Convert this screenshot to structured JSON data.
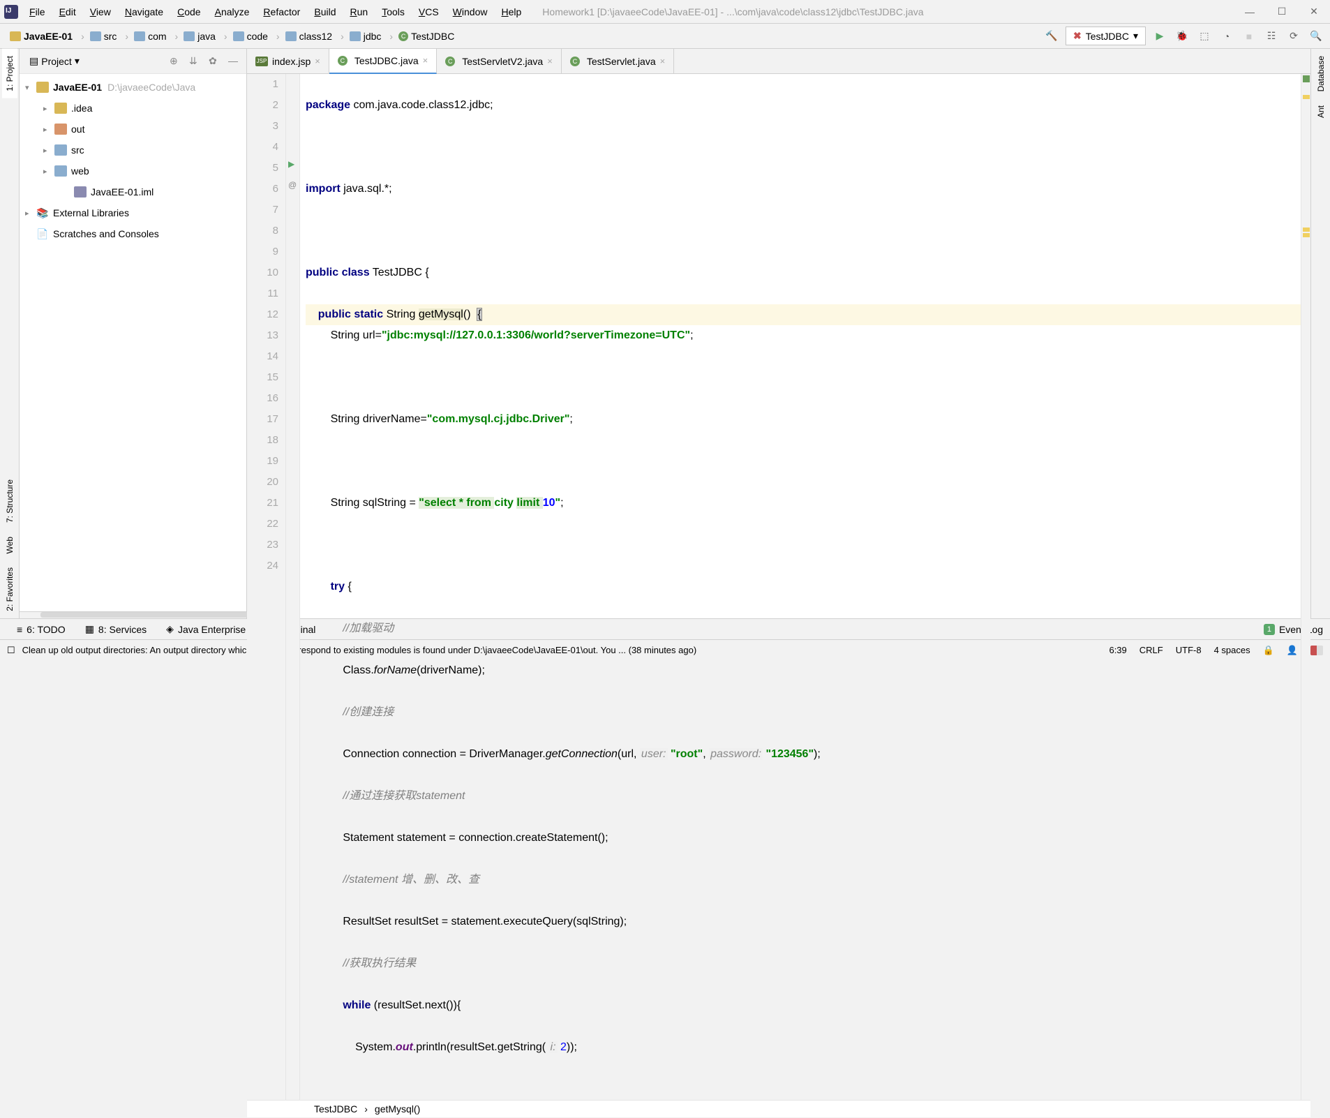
{
  "menu": [
    "File",
    "Edit",
    "View",
    "Navigate",
    "Code",
    "Analyze",
    "Refactor",
    "Build",
    "Run",
    "Tools",
    "VCS",
    "Window",
    "Help"
  ],
  "title_path": "Homework1 [D:\\javaeeCode\\JavaEE-01] - ...\\com\\java\\code\\class12\\jdbc\\TestJDBC.java",
  "breadcrumbs": [
    "JavaEE-01",
    "src",
    "com",
    "java",
    "code",
    "class12",
    "jdbc",
    "TestJDBC"
  ],
  "run_config": "TestJDBC",
  "project": {
    "header": "Project",
    "root_name": "JavaEE-01",
    "root_path": "D:\\javaeeCode\\Java",
    "items": [
      ".idea",
      "out",
      "src",
      "web",
      "JavaEE-01.iml"
    ],
    "external": "External Libraries",
    "scratches": "Scratches and Consoles"
  },
  "tabs": [
    {
      "label": "index.jsp",
      "type": "jsp"
    },
    {
      "label": "TestJDBC.java",
      "type": "class",
      "active": true
    },
    {
      "label": "TestServletV2.java",
      "type": "class"
    },
    {
      "label": "TestServlet.java",
      "type": "class"
    }
  ],
  "code": {
    "lines": [
      {
        "n": 1
      },
      {
        "n": 2
      },
      {
        "n": 3
      },
      {
        "n": 4
      },
      {
        "n": 5
      },
      {
        "n": 6
      },
      {
        "n": 7
      },
      {
        "n": 8
      },
      {
        "n": 9
      },
      {
        "n": 10
      },
      {
        "n": 11
      },
      {
        "n": 12
      },
      {
        "n": 13
      },
      {
        "n": 14
      },
      {
        "n": 15
      },
      {
        "n": 16
      },
      {
        "n": 17
      },
      {
        "n": 18
      },
      {
        "n": 19
      },
      {
        "n": 20
      },
      {
        "n": 21
      },
      {
        "n": 22
      },
      {
        "n": 23
      },
      {
        "n": 24
      }
    ],
    "c1_kw": "package",
    "c1_rest": " com.java.code.class12.jdbc;",
    "c3_kw": "import",
    "c3_rest": " java.sql.*;",
    "c5_kw1": "public",
    "c5_kw2": "class",
    "c5_rest": " TestJDBC {",
    "c6_kw1": "public",
    "c6_kw2": "static",
    "c6_rest1": " String ",
    "c6_method": "getMysql",
    "c6_rest2": "()",
    "c6_brace": "{",
    "c7_a": "        String url=",
    "c7_str": "\"jdbc:mysql://127.0.0.1:3306/world?serverTimezone=UTC\"",
    "c7_b": ";",
    "c9_a": "        String driverName=",
    "c9_str": "\"com.mysql.cj.jdbc.Driver\"",
    "c9_b": ";",
    "c11_a": "        String sqlString = ",
    "c11_s1": "\"select * from ",
    "c11_s2": "city ",
    "c11_s3": "limit ",
    "c11_s4": "10",
    "c11_s5": "\"",
    "c11_b": ";",
    "c13_kw": "try",
    "c13_rest": " {",
    "c14": "            //加载驱动",
    "c15_a": "            Class.",
    "c15_m": "forName",
    "c15_b": "(driverName);",
    "c16": "            //创建连接",
    "c17_a": "            Connection connection = DriverManager.",
    "c17_m": "getConnection",
    "c17_b": "(url, ",
    "c17_h1": "user:",
    "c17_s1": " \"root\"",
    "c17_c": ", ",
    "c17_h2": "password:",
    "c17_s2": " \"123456\"",
    "c17_d": ");",
    "c18": "            //通过连接获取statement",
    "c19": "            Statement statement = connection.createStatement();",
    "c20": "            //statement 增、删、改、查",
    "c21": "            ResultSet resultSet = statement.executeQuery(sqlString);",
    "c22": "            //获取执行结果",
    "c23_kw": "while",
    "c23_rest": " (resultSet.next()){",
    "c24_a": "                System.",
    "c24_out": "out",
    "c24_b": ".println(resultSet.getString( ",
    "c24_h": "i:",
    "c24_v": " 2",
    "c24_c": "));"
  },
  "editor_crumbs": [
    "TestJDBC",
    "getMysql()"
  ],
  "bottom_tools": {
    "todo": "6: TODO",
    "services": "8: Services",
    "javaee": "Java Enterprise",
    "terminal": "Terminal",
    "eventlog": "Event Log",
    "badge": "1"
  },
  "status": {
    "msg": "Clean up old output directories: An output directory which doesn't correspond to existing modules is found under D:\\javaeeCode\\JavaEE-01\\out. You ... (38 minutes ago)",
    "pos": "6:39",
    "eol": "CRLF",
    "enc": "UTF-8",
    "indent": "4 spaces"
  },
  "left_rail": [
    "1: Project",
    "7: Structure",
    "Web",
    "2: Favorites"
  ],
  "right_rail": [
    "Database",
    "Ant"
  ]
}
